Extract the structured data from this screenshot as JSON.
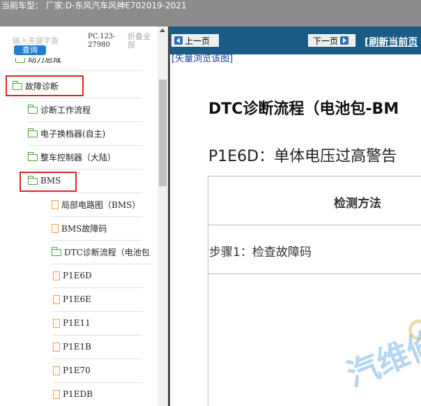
{
  "header": {
    "vehicle_info": "当前车型： 厂家:D-东风汽车风神E702019-2021"
  },
  "sidebar": {
    "search_placeholder": "输入关键字查",
    "query_label": "查询",
    "version": "PC.123-27980",
    "collapse_all": "折叠全部",
    "tree": [
      {
        "label": "动力总成",
        "icon": "folder-icon",
        "level": 1
      },
      {
        "label": "故障诊断",
        "icon": "folder-icon",
        "level": 1,
        "highlighted": true
      },
      {
        "label": "诊断工作流程",
        "icon": "folder-icon",
        "level": 2
      },
      {
        "label": "电子换档器(自主)",
        "icon": "folder-icon",
        "level": 2
      },
      {
        "label": "整车控制器（大陆）",
        "icon": "folder-icon",
        "level": 2
      },
      {
        "label": "BMS",
        "icon": "folder-icon",
        "level": 2,
        "highlighted": true
      },
      {
        "label": "局部电路图（BMS）",
        "icon": "document-icon",
        "level": 3
      },
      {
        "label": "BMS故障码",
        "icon": "document-icon",
        "level": 3
      },
      {
        "label": "DTC诊断流程（电池包",
        "icon": "folder-icon",
        "level": 3
      },
      {
        "label": "P1E6D",
        "icon": "document-icon",
        "level": 4
      },
      {
        "label": "P1E6E",
        "icon": "document-icon",
        "level": 4
      },
      {
        "label": "P1E11",
        "icon": "document-icon",
        "level": 4
      },
      {
        "label": "P1E1B",
        "icon": "document-icon",
        "level": 4
      },
      {
        "label": "P1E70",
        "icon": "document-icon",
        "level": 4
      },
      {
        "label": "P1EDB",
        "icon": "document-icon",
        "level": 4
      }
    ]
  },
  "toolbar": {
    "prev_label": "上一页",
    "next_label": "下一页",
    "refresh_label": "[刷新当前页"
  },
  "content": {
    "vector_link": "[矢量浏览该图]",
    "title": "DTC诊断流程（电池包-BM",
    "subtitle": "P1E6D：单体电压过高警告",
    "table_header": "检测方法",
    "step1": "步骤1：检查故障码",
    "watermark": "汽维修"
  },
  "colors": {
    "topbar": "#8c8c8c",
    "navbar": "#1a5c85",
    "highlight": "#e0241f",
    "folder": "#4ea33c",
    "document": "#f0a550",
    "query_button": "#1f7fd0"
  }
}
